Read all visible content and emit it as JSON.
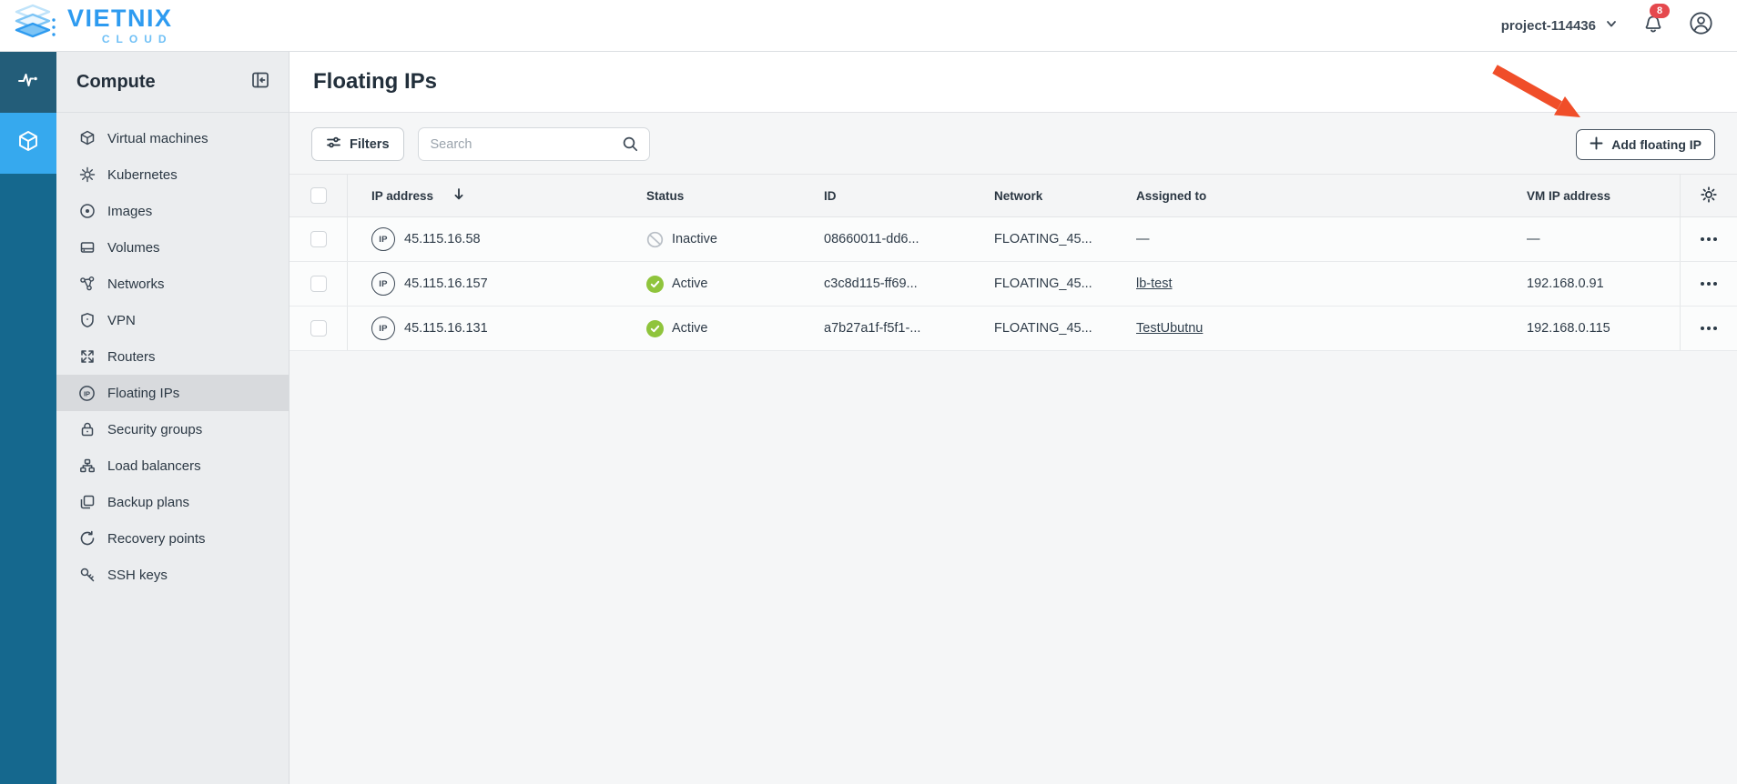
{
  "brand": {
    "name": "VIETNIX",
    "sub": "CLOUD"
  },
  "topbar": {
    "project_label": "project-114436",
    "notification_count": "8"
  },
  "rail": {
    "icons": [
      "activity-icon",
      "cube-icon-active"
    ]
  },
  "sidebar": {
    "title": "Compute",
    "items": [
      {
        "icon": "cube-icon",
        "label": "Virtual machines",
        "active": false
      },
      {
        "icon": "kubernetes-icon",
        "label": "Kubernetes",
        "active": false
      },
      {
        "icon": "images-icon",
        "label": "Images",
        "active": false
      },
      {
        "icon": "volumes-icon",
        "label": "Volumes",
        "active": false
      },
      {
        "icon": "networks-icon",
        "label": "Networks",
        "active": false
      },
      {
        "icon": "shield-icon",
        "label": "VPN",
        "active": false
      },
      {
        "icon": "routers-icon",
        "label": "Routers",
        "active": false
      },
      {
        "icon": "floating-ip-icon",
        "label": "Floating IPs",
        "active": true
      },
      {
        "icon": "lock-icon",
        "label": "Security groups",
        "active": false
      },
      {
        "icon": "load-balancer-icon",
        "label": "Load balancers",
        "active": false
      },
      {
        "icon": "backup-icon",
        "label": "Backup plans",
        "active": false
      },
      {
        "icon": "recovery-icon",
        "label": "Recovery points",
        "active": false
      },
      {
        "icon": "key-icon",
        "label": "SSH keys",
        "active": false
      }
    ]
  },
  "page": {
    "title": "Floating IPs"
  },
  "toolbar": {
    "filters_label": "Filters",
    "search_placeholder": "Search",
    "add_button_label": "Add floating IP"
  },
  "table": {
    "columns": {
      "ip": "IP address",
      "status": "Status",
      "id": "ID",
      "network": "Network",
      "assigned": "Assigned to",
      "vm_ip": "VM IP address"
    },
    "rows": [
      {
        "ip": "45.115.16.58",
        "status": "Inactive",
        "status_type": "inactive",
        "id": "08660011-dd6...",
        "network": "FLOATING_45...",
        "assigned": "—",
        "vm_ip": "—"
      },
      {
        "ip": "45.115.16.157",
        "status": "Active",
        "status_type": "active",
        "id": "c3c8d115-ff69...",
        "network": "FLOATING_45...",
        "assigned": "lb-test",
        "vm_ip": "192.168.0.91"
      },
      {
        "ip": "45.115.16.131",
        "status": "Active",
        "status_type": "active",
        "id": "a7b27a1f-f5f1-...",
        "network": "FLOATING_45...",
        "assigned": "TestUbutnu",
        "vm_ip": "192.168.0.115"
      }
    ]
  },
  "colors": {
    "brand_blue": "#2e9bf0",
    "rail_teal": "#15688e",
    "rail_dark": "#235d79",
    "rail_active_blue": "#36a9ee",
    "sidebar_bg": "#ebedef",
    "sidebar_active_item": "#d8dadd",
    "status_active_green": "#8fc43c",
    "status_inactive_gray": "#b9bfc6",
    "notification_red": "#e5484d",
    "annotation_arrow_red": "#f04e29",
    "text_dark": "#2e3b48"
  }
}
